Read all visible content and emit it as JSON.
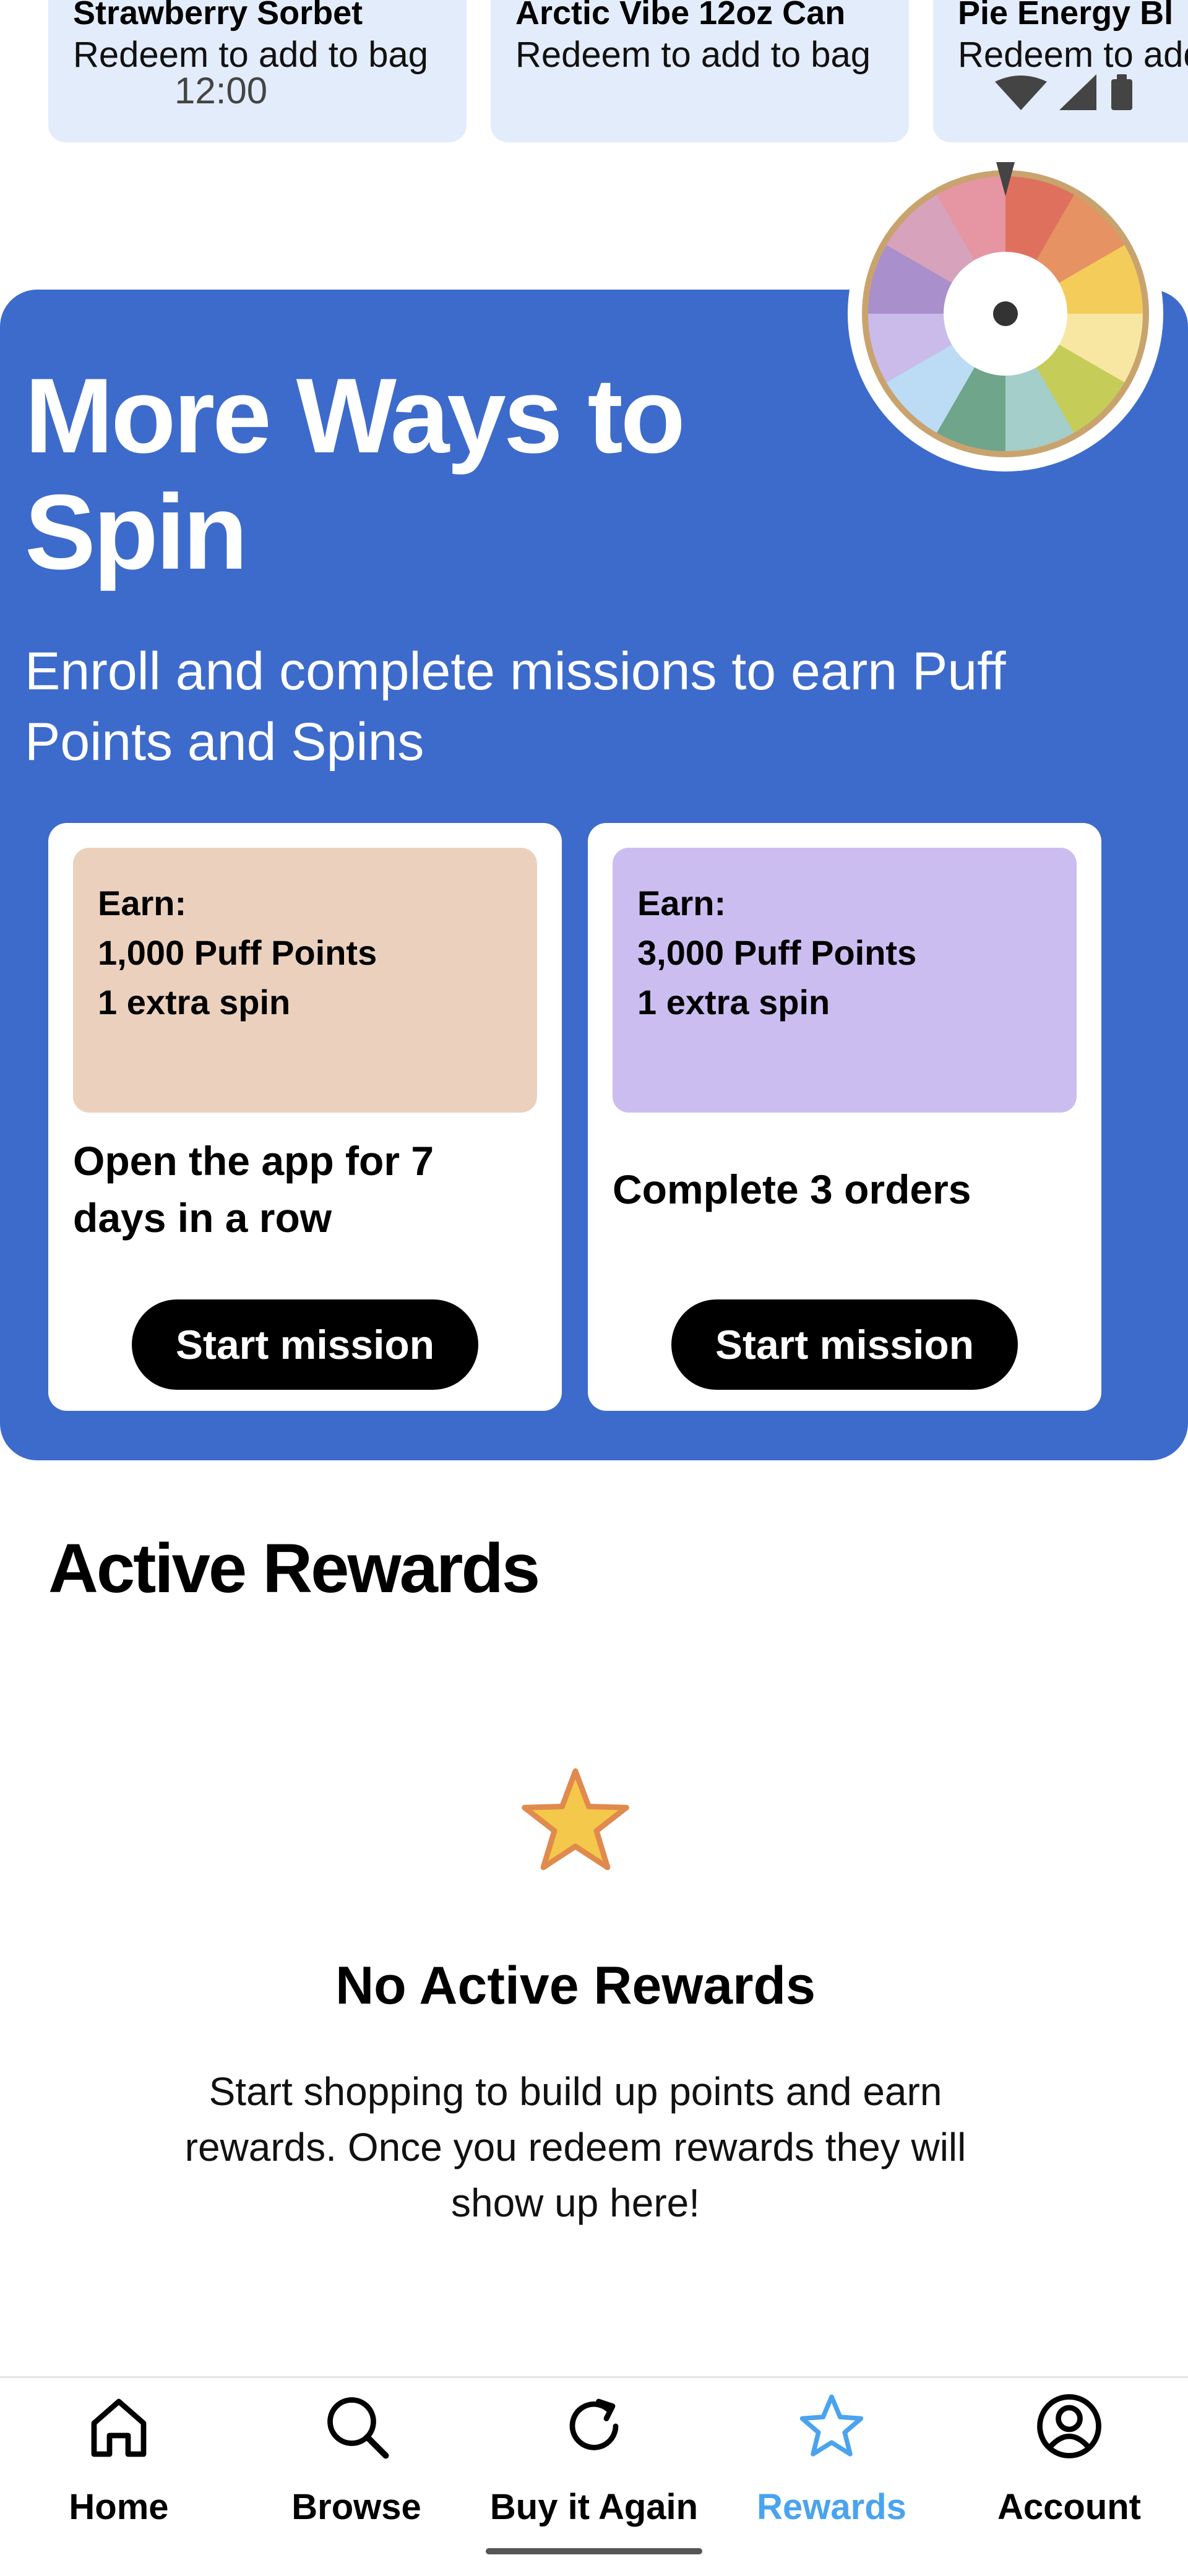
{
  "status_bar": {
    "time": "12:00"
  },
  "reward_cards": [
    {
      "name": "Strawberry Sorbet",
      "action": "Redeem to add to bag"
    },
    {
      "name": "Arctic Vibe 12oz Can",
      "action": "Redeem to add to bag"
    },
    {
      "name": "Pie Energy Bl",
      "action": "Redeem to add"
    }
  ],
  "banner": {
    "title": "More Ways to Spin",
    "subtitle": "Enroll and complete missions to earn Puff Points and Spins",
    "missions": [
      {
        "earn_label": "Earn:",
        "points": "1,000 Puff Points",
        "spin": "1 extra spin",
        "description": "Open the app for 7 days in a row",
        "button": "Start mission",
        "color": "#ebd1bd"
      },
      {
        "earn_label": "Earn:",
        "points": "3,000 Puff Points",
        "spin": "1 extra spin",
        "description": "Complete 3 orders",
        "button": "Start mission",
        "color": "#ccbdf1"
      }
    ]
  },
  "active_rewards": {
    "title": "Active Rewards",
    "empty_title": "No Active Rewards",
    "empty_description": "Start shopping to build up points and earn rewards. Once you redeem rewards they will show up here!"
  },
  "bottom_nav": {
    "items": [
      {
        "label": "Home",
        "icon": "home-icon",
        "active": false
      },
      {
        "label": "Browse",
        "icon": "search-icon",
        "active": false
      },
      {
        "label": "Buy it Again",
        "icon": "refresh-icon",
        "active": false
      },
      {
        "label": "Rewards",
        "icon": "star-icon",
        "active": true
      },
      {
        "label": "Account",
        "icon": "account-icon",
        "active": false
      }
    ]
  },
  "colors": {
    "banner": "#3d6bcc",
    "card": "#e3ecfa",
    "active_nav": "#4aa3ef",
    "star_fill": "#f4c84a",
    "star_stroke": "#e08a4e"
  }
}
